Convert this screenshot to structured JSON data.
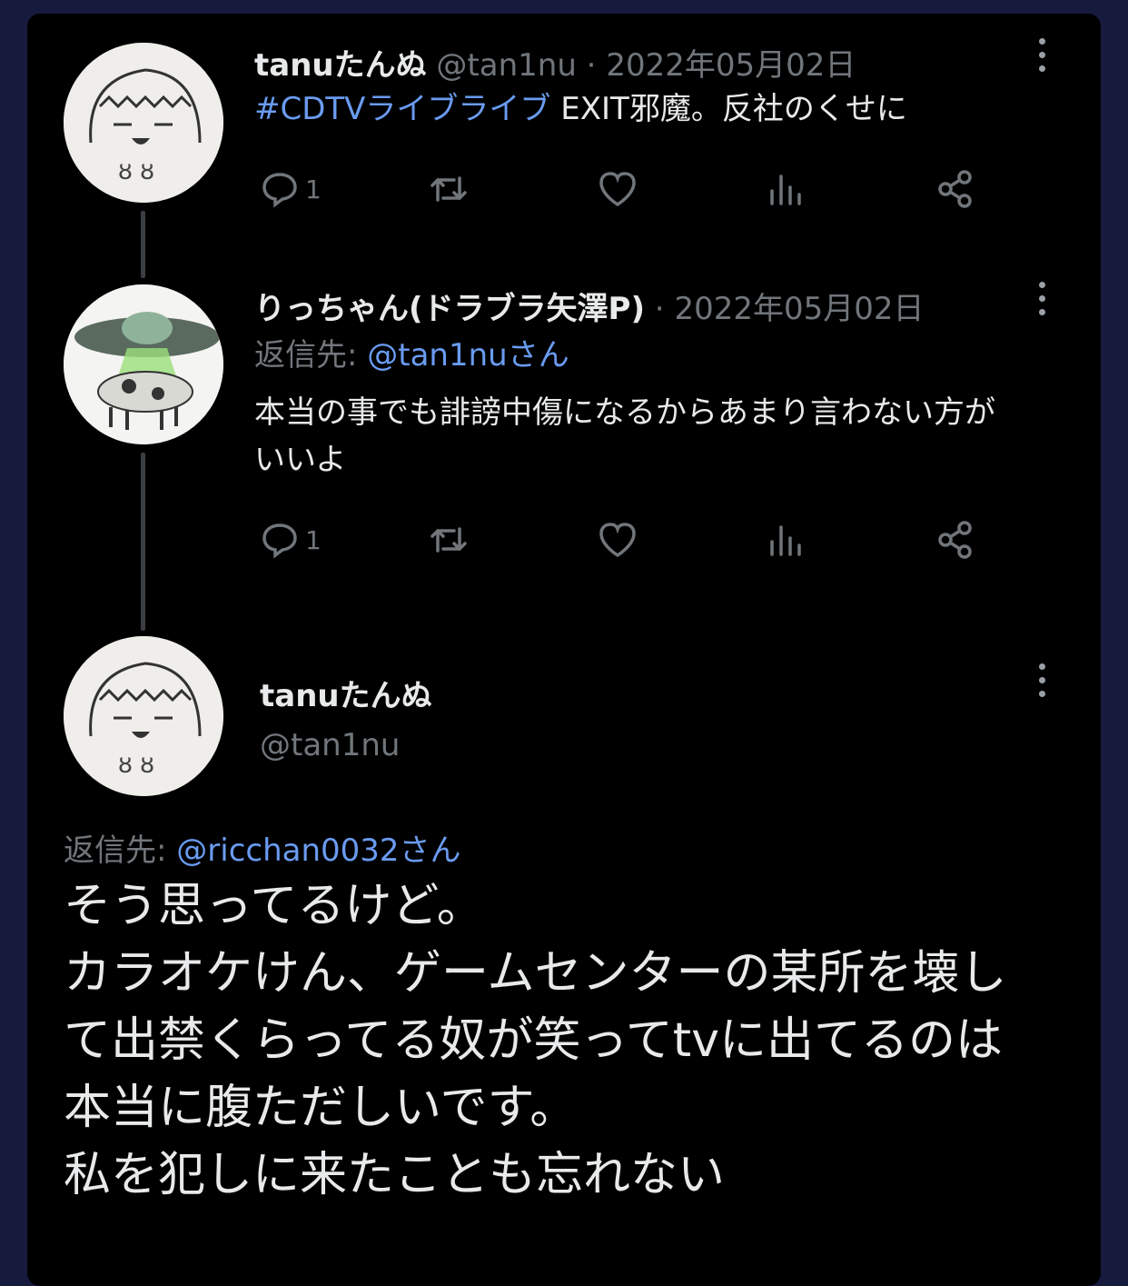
{
  "tweets": [
    {
      "name": "tanuたんぬ",
      "handle": "@tan1nu",
      "sep": " · ",
      "date": "2022年05月02日",
      "hashtag": "#CDTVライブライブ",
      "text": " EXIT邪魔。反社のくせに",
      "reply_count": "1"
    },
    {
      "name": "りっちゃん(ドラブラ矢澤P)",
      "sep": " · ",
      "date": "2022年05月02日",
      "reply_to_label": "返信先: ",
      "reply_to_handle": "@tan1nuさん",
      "text_line1": "本当の事でも誹謗中傷になるからあまり言わない方が",
      "text_line2": "いいよ",
      "reply_count": "1"
    }
  ],
  "main_tweet": {
    "name": "tanuたんぬ",
    "handle": "@tan1nu",
    "reply_to_label": "返信先: ",
    "reply_to_handle": "@ricchan0032さん",
    "lines": [
      "そう思ってるけど。",
      "カラオケけん、ゲームセンターの某所を壊し",
      "て出禁くらってる奴が笑ってtvに出てるのは",
      "本当に腹ただしいです。",
      "私を犯しに来たことも忘れない"
    ]
  },
  "colors": {
    "background": "#161a3d",
    "panel": "#000000",
    "link": "#6a9bf0",
    "muted": "#71767b"
  },
  "icons": [
    "reply-icon",
    "retweet-icon",
    "like-icon",
    "views-icon",
    "share-icon",
    "more-icon"
  ]
}
